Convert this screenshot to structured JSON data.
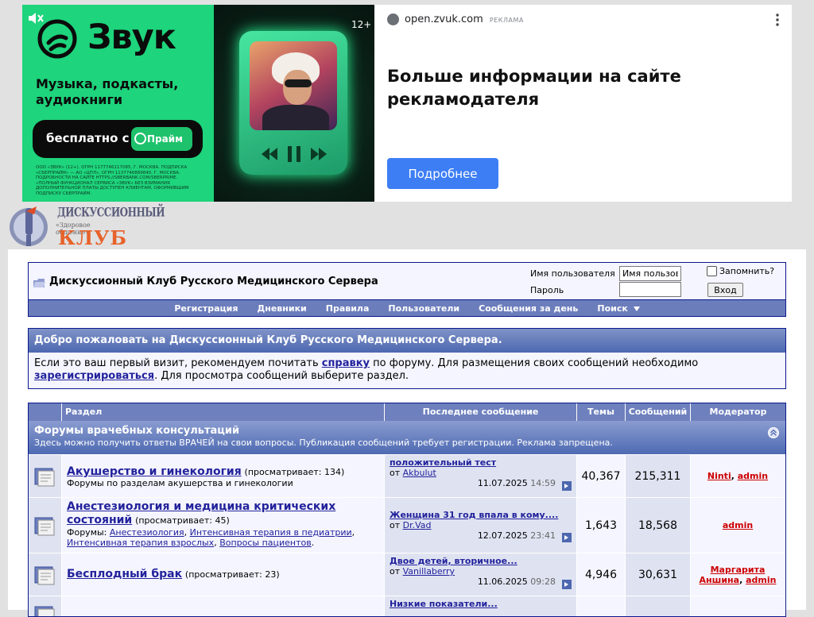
{
  "ad": {
    "brand": "Звук",
    "age": "12+",
    "tagline": "Музыка, подкасты, аудиокниги",
    "pill_text": "бесплатно с",
    "prime_label": "Прайм",
    "legal": "ООО «Звук» (12+). ОГРН 1177746117085, г. Москва. Подписка «СберПрайм» — АО «ЦПЛ», ОГРН 1137746889840, г. Москва. Подробности на сайте https://sberbank.com/sberprime. «Полный функционал сервиса «Звук» без взимания дополнительной платы доступен клиентам, оформившим подписку СберПрайм.",
    "domain": "open.zvuk.com",
    "ad_label": "РЕКЛАМА",
    "headline": "Больше информации на сайте рекламодателя",
    "cta": "Подробнее",
    "colors": {
      "brand_green": "#1ed47c",
      "cta_blue": "#3d7ef5"
    }
  },
  "logo": {
    "top_text": "ДИСКУССИОННЫЙ",
    "mid_text": "«Здоровое общение»",
    "big_text": "КЛУБ"
  },
  "navbar": {
    "title": "Дискуссионный Клуб Русского Медицинского Сервера",
    "username_label": "Имя пользователя",
    "username_value": "Имя пользователя",
    "password_label": "Пароль",
    "remember_label": "Запомнить?",
    "login_button": "Вход",
    "links": [
      {
        "label": "Регистрация"
      },
      {
        "label": "Дневники"
      },
      {
        "label": "Правила"
      },
      {
        "label": "Пользователи"
      },
      {
        "label": "Сообщения за день"
      },
      {
        "label": "Поиск"
      }
    ]
  },
  "welcome": {
    "title": "Добро пожаловать на Дискуссионный Клуб Русского Медицинского Сервера.",
    "text_1": "Если это ваш первый визит, рекомендуем почитать ",
    "link_help": "справку",
    "text_2": " по форуму. Для размещения своих сообщений необходимо ",
    "link_register": "зарегистрироваться",
    "text_3": ". Для просмотра сообщений выберите раздел."
  },
  "forum": {
    "headers": {
      "section": "Раздел",
      "last_post": "Последнее сообщение",
      "threads": "Темы",
      "posts": "Сообщений",
      "moderator": "Модератор"
    },
    "category_title": "Форумы врачебных консультаций",
    "category_desc": "Здесь можно получить ответы ВРАЧЕЙ на свои вопросы. Публикация сообщений требует регистрации. Реклама запрещена.",
    "rows": [
      {
        "title": "Акушерство и гинекология",
        "viewing": "(просматривает: 134)",
        "desc": "Форумы по разделам акушерства и гинекологии",
        "last_title": "положительный тест",
        "last_by_prefix": "от",
        "last_by": "Akbulut",
        "last_date": "11.07.2025",
        "last_time": "14:59",
        "threads": "40,367",
        "posts": "215,311",
        "mod_1": "Ninti",
        "mod_2": "admin"
      },
      {
        "title": "Анестезиология и медицина критических состояний",
        "viewing": "(просматривает: 45)",
        "subforums_label": "Форумы:",
        "sub_1": "Анестезиология",
        "sub_2": "Интенсивная терапия в педиатрии",
        "sub_3": "Интенсивная терапия взрослых",
        "sub_4": "Вопросы пациентов",
        "last_title": "Женщина 31 год впала в кому....",
        "last_by_prefix": "от",
        "last_by": "Dr.Vad",
        "last_date": "12.07.2025",
        "last_time": "23:41",
        "threads": "1,643",
        "posts": "18,568",
        "mod_1": "admin"
      },
      {
        "title": "Бесплодный брак",
        "viewing": "(просматривает: 23)",
        "last_title": "Двое детей, вторичное...",
        "last_by_prefix": "от",
        "last_by": "Vanillaberry",
        "last_date": "11.06.2025",
        "last_time": "09:28",
        "threads": "4,946",
        "posts": "30,631",
        "mod_1": "Маргарита Аншина",
        "mod_2": "admin"
      },
      {
        "last_title": "Низкие показатели..."
      }
    ]
  }
}
